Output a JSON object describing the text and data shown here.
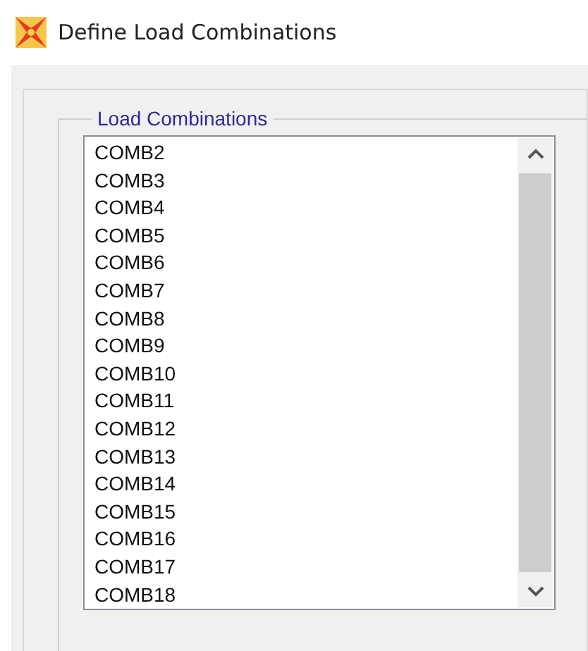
{
  "window": {
    "title": "Define Load Combinations"
  },
  "group": {
    "label": "Load Combinations"
  },
  "list": {
    "items": [
      "COMB2",
      "COMB3",
      "COMB4",
      "COMB5",
      "COMB6",
      "COMB7",
      "COMB8",
      "COMB9",
      "COMB10",
      "COMB11",
      "COMB12",
      "COMB13",
      "COMB14",
      "COMB15",
      "COMB16",
      "COMB17",
      "COMB18"
    ]
  }
}
